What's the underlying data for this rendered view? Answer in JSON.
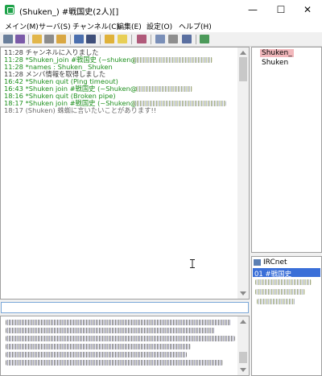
{
  "window": {
    "title": "(Shuken_) #戦国史(2人)[]",
    "controls": {
      "minimize": "—",
      "maximize": "☐",
      "close": "✕"
    }
  },
  "menu": [
    {
      "label": "メイン(M)"
    },
    {
      "label": "サーバ(S)"
    },
    {
      "label": "チャンネル(C)"
    },
    {
      "label": "編集(E)"
    },
    {
      "label": "設定(O)"
    },
    {
      "label": "ヘルプ(H)"
    }
  ],
  "log": [
    {
      "time": "11:28",
      "text": "チャンネルに入りました",
      "color": "dark"
    },
    {
      "time": "11:28",
      "text": "*Shuken_join #戦国史 (~shuken@",
      "color": "green"
    },
    {
      "time": "11:28",
      "text": "*names : Shuken_ Shuken",
      "color": "green"
    },
    {
      "time": "11:28",
      "text": "メンバ情報を取得しました",
      "color": "dark"
    },
    {
      "time": "16:42",
      "text": "*Shuken quit (Ping timeout)",
      "color": "green"
    },
    {
      "time": "16:43",
      "text": "*Shuken join #戦国史 (~Shuken@",
      "color": "green"
    },
    {
      "time": "18:16",
      "text": "*Shuken quit (Broken pipe)",
      "color": "green"
    },
    {
      "time": "18:17",
      "text": "*Shuken join #戦国史 (~Shuken@",
      "color": "green"
    },
    {
      "time": "18:17",
      "text": "(Shuken) 蛛蜘に言いたいことがあります!!",
      "color": "gray"
    }
  ],
  "nicklist": [
    {
      "name": "Shuken_",
      "highlight": true
    },
    {
      "name": "Shuken",
      "highlight": false
    }
  ],
  "channel_tree": {
    "network": "IRCnet",
    "selected": "01 #戦国史"
  },
  "input": {
    "value": ""
  }
}
